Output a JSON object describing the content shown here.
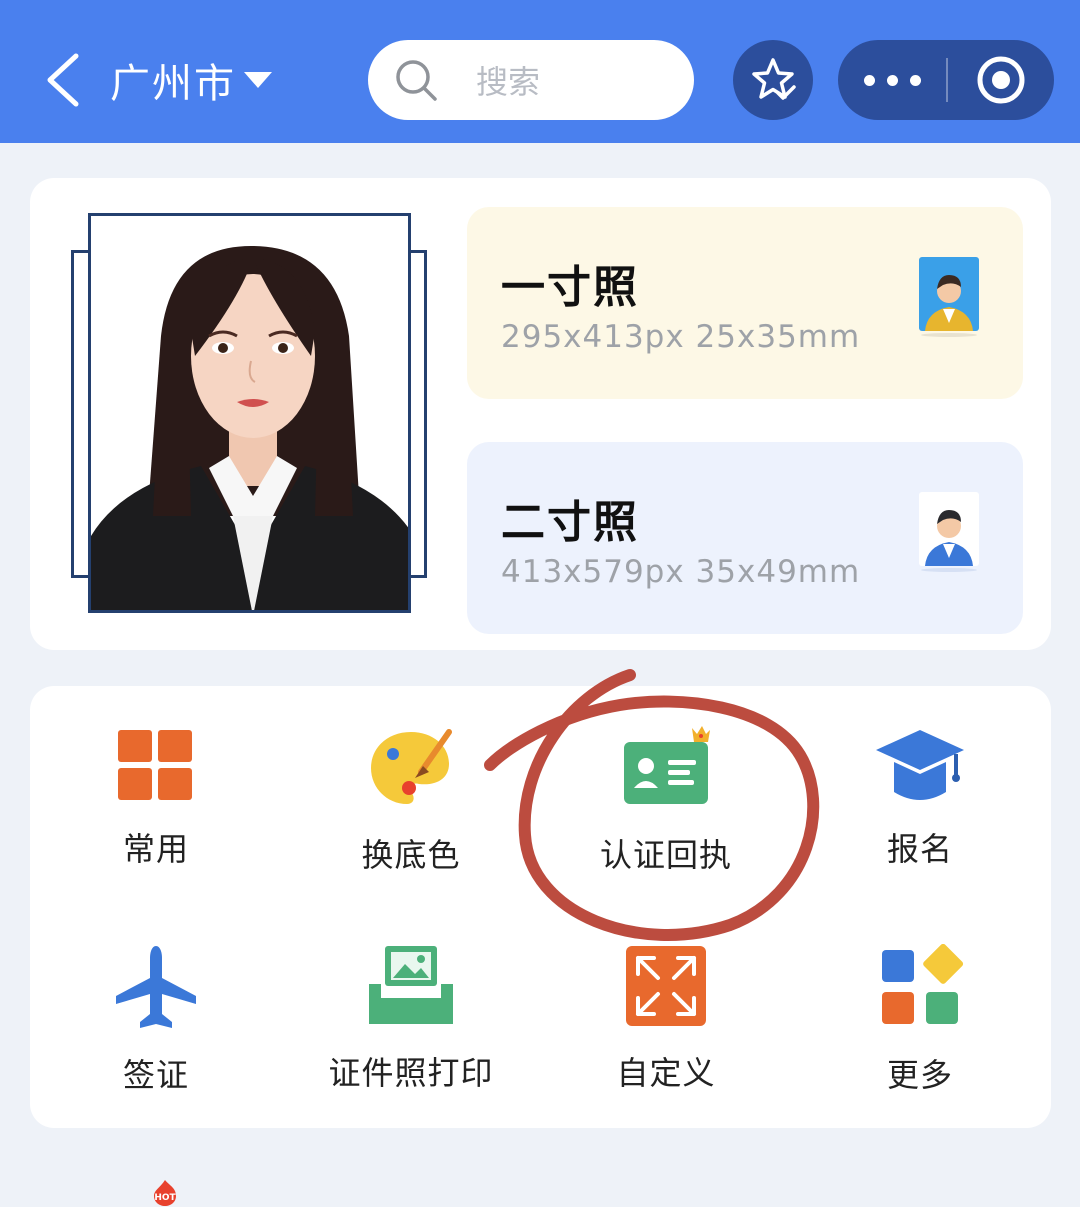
{
  "header": {
    "city": "广州市",
    "search_placeholder": "搜索"
  },
  "photo_sizes": [
    {
      "title": "一寸照",
      "spec": "295x413px  25x35mm"
    },
    {
      "title": "二寸照",
      "spec": "413x579px  35x49mm"
    }
  ],
  "tools": [
    {
      "label": "常用",
      "icon": "grid-blocks-icon"
    },
    {
      "label": "换底色",
      "icon": "palette-icon"
    },
    {
      "label": "认证回执",
      "icon": "id-card-crown-icon"
    },
    {
      "label": "报名",
      "icon": "graduation-cap-icon"
    },
    {
      "label": "签证",
      "icon": "airplane-icon"
    },
    {
      "label": "证件照打印",
      "icon": "printer-photo-icon"
    },
    {
      "label": "自定义",
      "icon": "expand-arrows-icon"
    },
    {
      "label": "更多",
      "icon": "more-apps-icon"
    }
  ],
  "bottom_tabs": {
    "badge": "HOT"
  },
  "colors": {
    "header_bg": "#4a80ee",
    "capsule_bg": "#2c4e9c",
    "annotation_circle": "#b5382a"
  }
}
